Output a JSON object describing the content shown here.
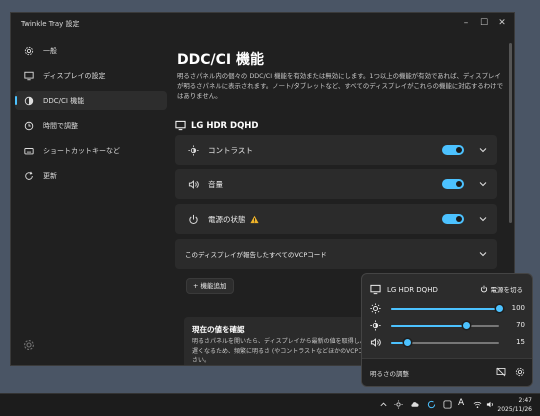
{
  "window": {
    "title": "Twinkle Tray 設定"
  },
  "sidebar": {
    "items": [
      {
        "label": "一般",
        "icon": "gear-icon"
      },
      {
        "label": "ディスプレイの設定",
        "icon": "monitor-icon"
      },
      {
        "label": "DDC/CI 機能",
        "icon": "adjust-icon",
        "active": true
      },
      {
        "label": "時間で調整",
        "icon": "clock-icon"
      },
      {
        "label": "ショートカットキーなど",
        "icon": "keyboard-icon"
      },
      {
        "label": "更新",
        "icon": "refresh-icon"
      }
    ]
  },
  "main": {
    "title": "DDC/CI 機能",
    "description": "明るさパネル内の個々の DDC/CI 機能を有効または無効にします。1つ以上の機能が有効であれば、ディスプレイが明るさパネルに表示されます。ノート/タブレットなど、すべてのディスプレイがこれらの機能に対応するわけではありません。",
    "monitor_name": "LG HDR DQHD",
    "features": [
      {
        "label": "コントラスト",
        "enabled": true
      },
      {
        "label": "音量",
        "enabled": true
      },
      {
        "label": "電源の状態",
        "enabled": true,
        "warning": true
      }
    ],
    "vcp_row_label": "このディスプレイが報告したすべてのVCPコード",
    "add_button": "+ 機能追加",
    "current_values": {
      "heading": "現在の値を確認",
      "text": "明るさパネルを開いたら、ディスプレイから最新の値を取得しようとします。これにより明るさパネルの反応が遅くなるため、頻繁に明るさ (やコントラストなどほかのVCPコード) が変更される場合にのみ有効にしてください。"
    }
  },
  "flyout": {
    "monitor_name": "LG HDR DQHD",
    "power_off_label": "電源を切る",
    "sliders": [
      {
        "name": "brightness",
        "value": "100",
        "level": 1.0
      },
      {
        "name": "contrast",
        "value": "70",
        "level": 0.7
      },
      {
        "name": "volume",
        "value": "15",
        "level": 0.15
      }
    ],
    "footer_label": "明るさの調整"
  },
  "taskbar": {
    "time": "2:47",
    "date": "2025/11/26",
    "ime": "A"
  },
  "colors": {
    "accent": "#4cc2ff",
    "warning": "#f0b429"
  }
}
